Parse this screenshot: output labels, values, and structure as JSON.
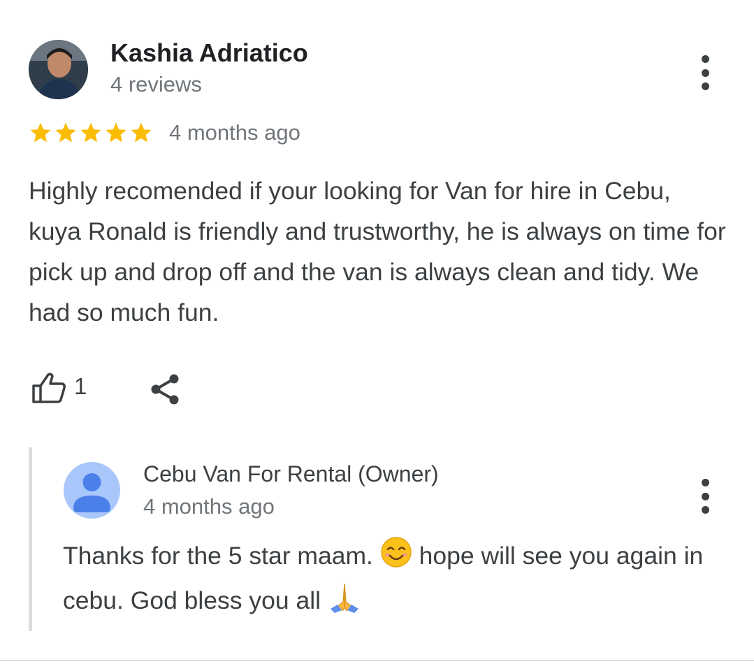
{
  "review": {
    "author_name": "Kashia Adriatico",
    "author_meta": "4 reviews",
    "rating": 5,
    "rating_max": 5,
    "date": "4 months ago",
    "text": "Highly recomended if your looking for Van for hire in Cebu, kuya Ronald is friendly and trustworthy, he is always on time for pick up and drop off and the van is always clean and tidy. We had so much fun.",
    "like_count": "1",
    "icons": {
      "more": "more-vert-icon",
      "like": "thumbs-up-icon",
      "share": "share-icon",
      "star": "star-icon"
    }
  },
  "owner_reply": {
    "name": "Cebu Van For Rental (Owner)",
    "date": "4 months ago",
    "text_part1": "Thanks for the 5 star maam. ",
    "text_part2": " hope will see you again in cebu. God bless you all ",
    "emoji_1": "smiling-face-icon",
    "emoji_2": "folded-hands-icon"
  },
  "colors": {
    "star": "#fbbc04",
    "text_primary": "#202124",
    "text_secondary": "#70757a",
    "owner_avatar_bg": "#a9c7fb",
    "owner_avatar_fg": "#4a80e8",
    "reply_bar": "#dadce0"
  }
}
